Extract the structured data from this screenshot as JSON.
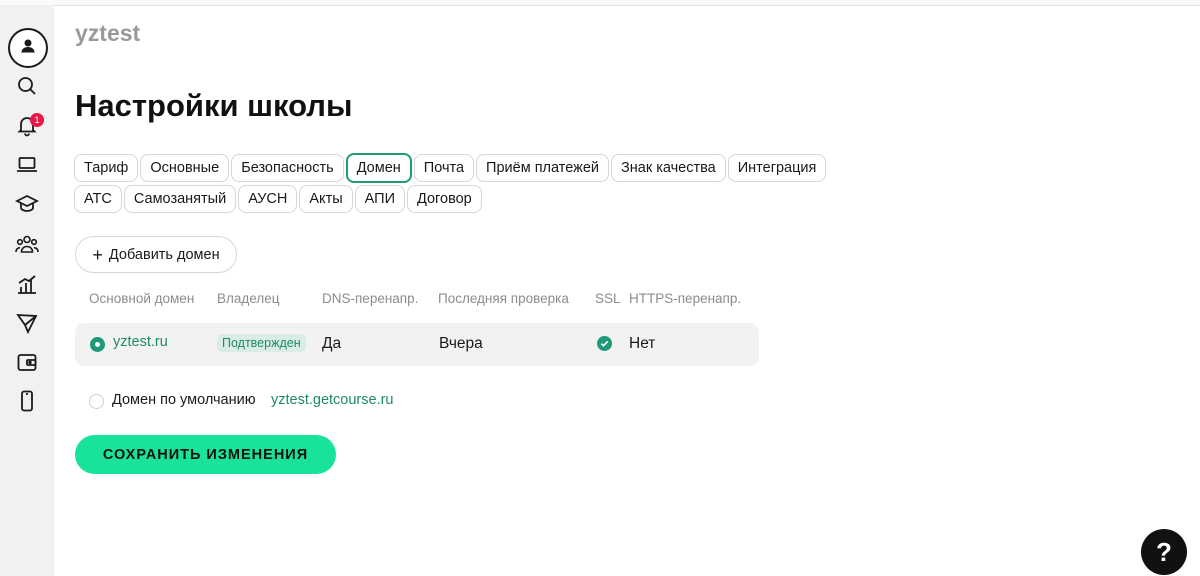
{
  "sidebar": {
    "items": [
      {
        "name": "profile",
        "icon": "user-icon"
      },
      {
        "name": "search",
        "icon": "search-icon"
      },
      {
        "name": "notifications",
        "icon": "bell-icon",
        "badge": "1"
      },
      {
        "name": "laptop",
        "icon": "laptop-icon"
      },
      {
        "name": "education",
        "icon": "graduation-cap-icon"
      },
      {
        "name": "users",
        "icon": "users-icon"
      },
      {
        "name": "analytics",
        "icon": "chart-icon"
      },
      {
        "name": "send",
        "icon": "send-icon"
      },
      {
        "name": "wallet",
        "icon": "wallet-icon"
      },
      {
        "name": "mobile",
        "icon": "mobile-icon"
      }
    ]
  },
  "header": {
    "school_name": "yztest",
    "page_title": "Настройки школы"
  },
  "tabs": {
    "row1": [
      "Тариф",
      "Основные",
      "Безопасность",
      "Домен",
      "Почта",
      "Приём платежей",
      "Знак качества",
      "Интеграция"
    ],
    "row2": [
      "АТС",
      "Самозанятый",
      "АУСН",
      "Акты",
      "АПИ",
      "Договор"
    ],
    "active": "Домен"
  },
  "domains": {
    "add_button_label": "Добавить домен",
    "columns": [
      "Основной домен",
      "Владелец",
      "DNS-перенапр.",
      "Последняя проверка",
      "SSL",
      "HTTPS-перенапр."
    ],
    "rows": [
      {
        "domain": "yztest.ru",
        "owner_status": "Подтвержден",
        "dns": "Да",
        "last_check": "Вчера",
        "ssl": "ok",
        "https": "Нет",
        "selected": true
      }
    ],
    "default_domain_label": "Домен по умолчанию",
    "default_domain_value": "yztest.getcourse.ru"
  },
  "actions": {
    "save_label": "СОХРАНИТЬ ИЗМЕНЕНИЯ",
    "help_label": "?"
  },
  "colors": {
    "accent": "#1f9a78",
    "save_button": "#19e39a",
    "badge": "#e8194a"
  }
}
